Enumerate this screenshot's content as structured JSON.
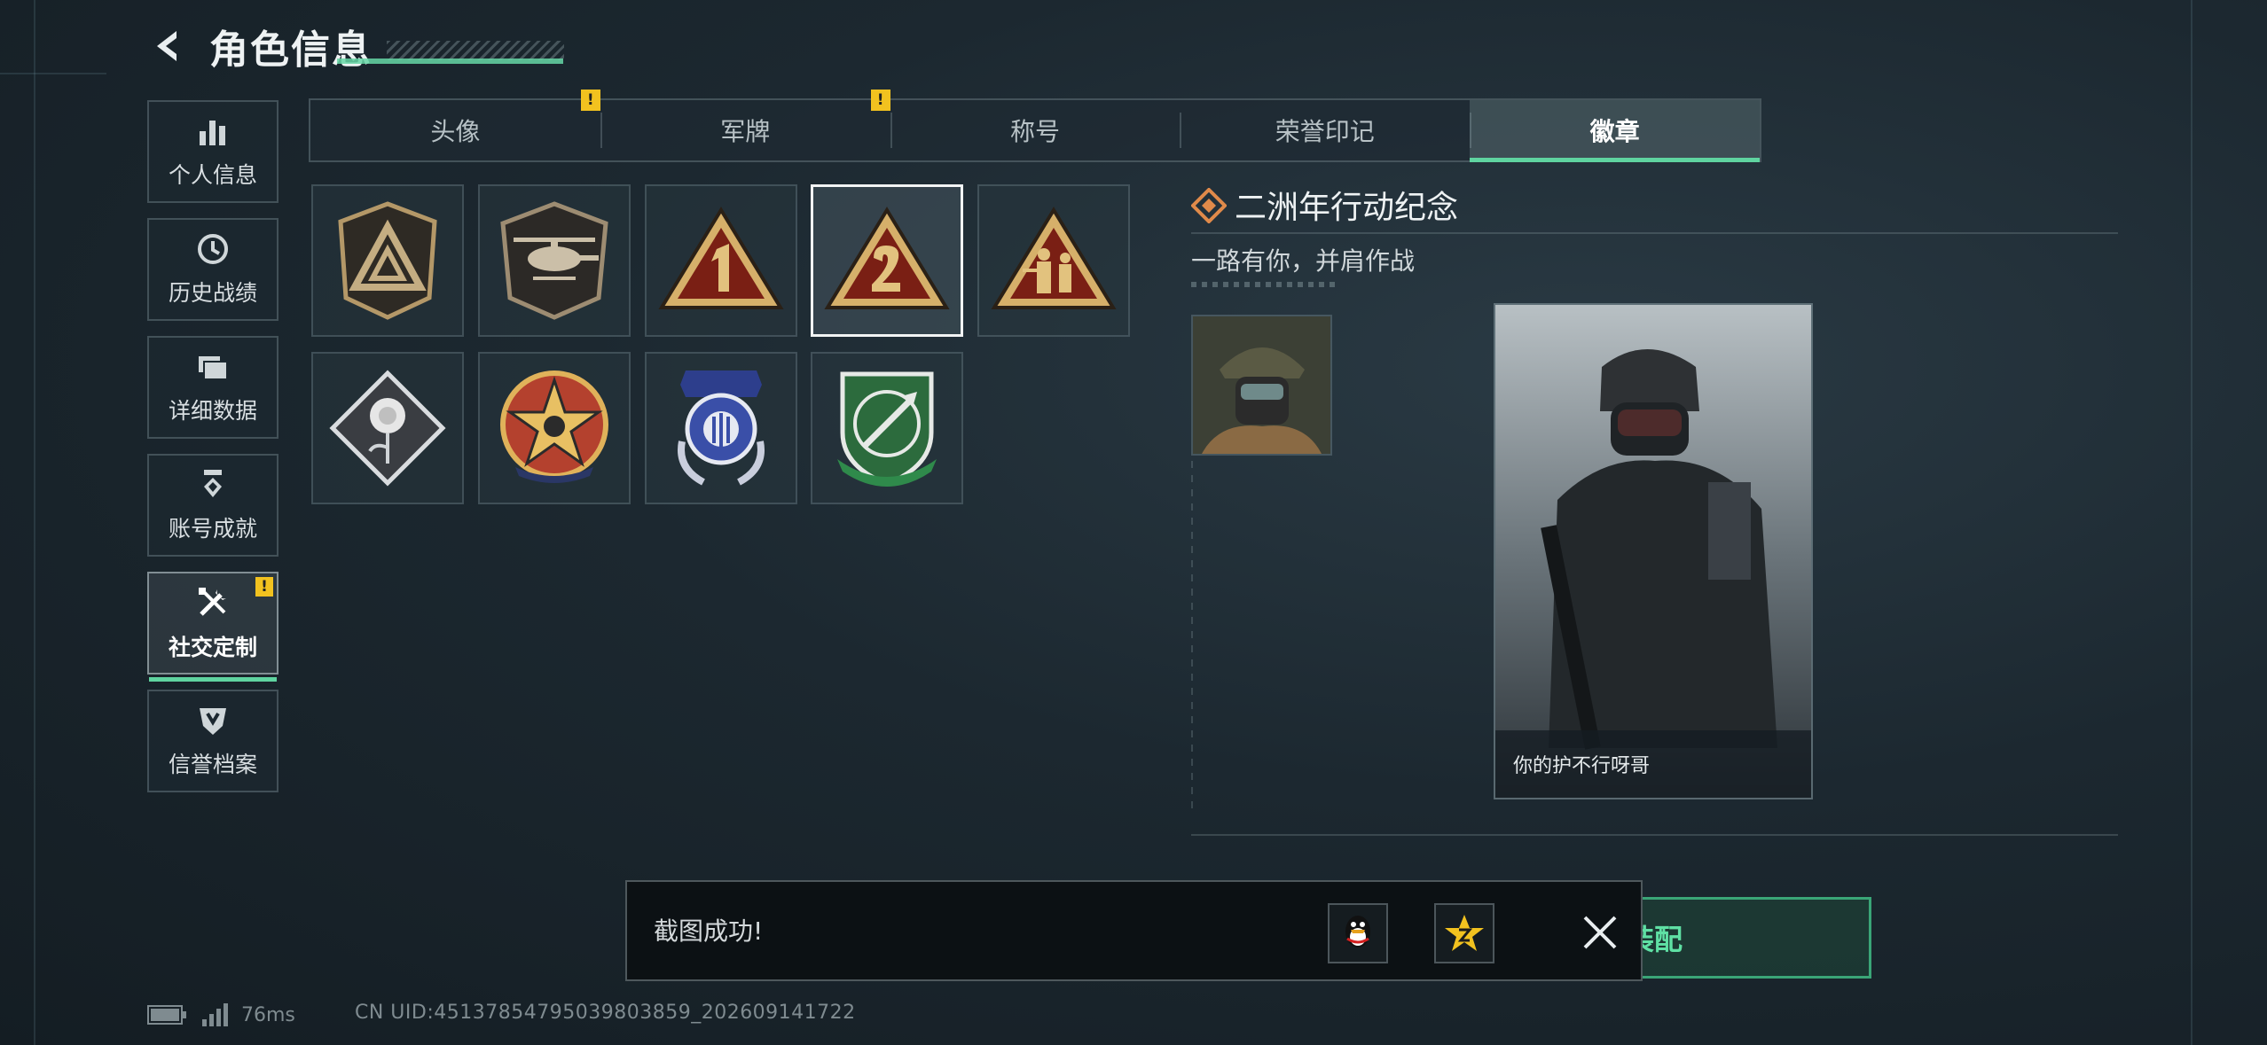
{
  "header": {
    "title": "角色信息"
  },
  "sidebar": {
    "items": [
      {
        "label": "个人信息",
        "icon": "bar-chart-icon"
      },
      {
        "label": "历史战绩",
        "icon": "clock-icon"
      },
      {
        "label": "详细数据",
        "icon": "folder-icon"
      },
      {
        "label": "账号成就",
        "icon": "medal-icon"
      },
      {
        "label": "社交定制",
        "icon": "tools-icon",
        "active": true,
        "badge": "!"
      },
      {
        "label": "信誉档案",
        "icon": "shield-icon"
      }
    ]
  },
  "tabs": [
    {
      "label": "头像",
      "badge": "!"
    },
    {
      "label": "军牌",
      "badge": "!"
    },
    {
      "label": "称号"
    },
    {
      "label": "荣誉印记"
    },
    {
      "label": "徽章",
      "active": true
    }
  ],
  "badges": [
    {
      "name": "triangle-emblem-badge"
    },
    {
      "name": "helicopter-badge"
    },
    {
      "name": "anniversary-1-badge"
    },
    {
      "name": "anniversary-2-badge",
      "selected": true
    },
    {
      "name": "soldiers-badge"
    },
    {
      "name": "rose-badge"
    },
    {
      "name": "star-wreath-badge"
    },
    {
      "name": "blue-wings-badge"
    },
    {
      "name": "green-knife-badge"
    }
  ],
  "detail": {
    "title": "二洲年行动纪念",
    "subtitle": "一路有你，并肩作战",
    "card_caption": "你的护不行呀哥"
  },
  "equip_button": {
    "label": "装配"
  },
  "toast": {
    "message": "截图成功!"
  },
  "status": {
    "ping": "76ms",
    "uid": "CN UID:4513785479503980385​9_202609141722"
  },
  "colors": {
    "accent": "#5fd4a0",
    "warning": "#f2c21f",
    "badge_gold": "#d8b266"
  }
}
